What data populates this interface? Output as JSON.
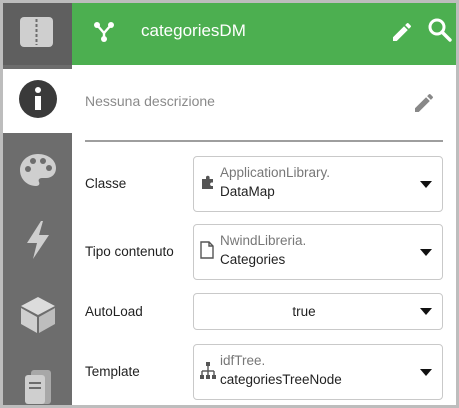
{
  "header": {
    "title": "categoriesDM"
  },
  "description": {
    "text": "Nessuna descrizione"
  },
  "fields": {
    "classe": {
      "label": "Classe",
      "line1": "ApplicationLibrary.",
      "line2": "DataMap"
    },
    "tipo": {
      "label": "Tipo contenuto",
      "line1": "NwindLibreria.",
      "line2": "Categories"
    },
    "autoload": {
      "label": "AutoLoad",
      "value": "true"
    },
    "template": {
      "label": "Template",
      "line1": "idfTree.",
      "line2": "categoriesTreeNode"
    }
  },
  "colors": {
    "header_green": "#4caf50",
    "rail_gray": "#6d6d6d",
    "icon_light": "#cfcfcf"
  },
  "icons": [
    "book-icon",
    "graph-node-icon",
    "pencil-icon",
    "search-icon",
    "info-icon",
    "palette-icon",
    "lightning-icon",
    "cube-icon",
    "document-stack-icon",
    "puzzle-piece-icon",
    "file-icon",
    "tree-hierarchy-icon",
    "dropdown-caret-icon"
  ]
}
